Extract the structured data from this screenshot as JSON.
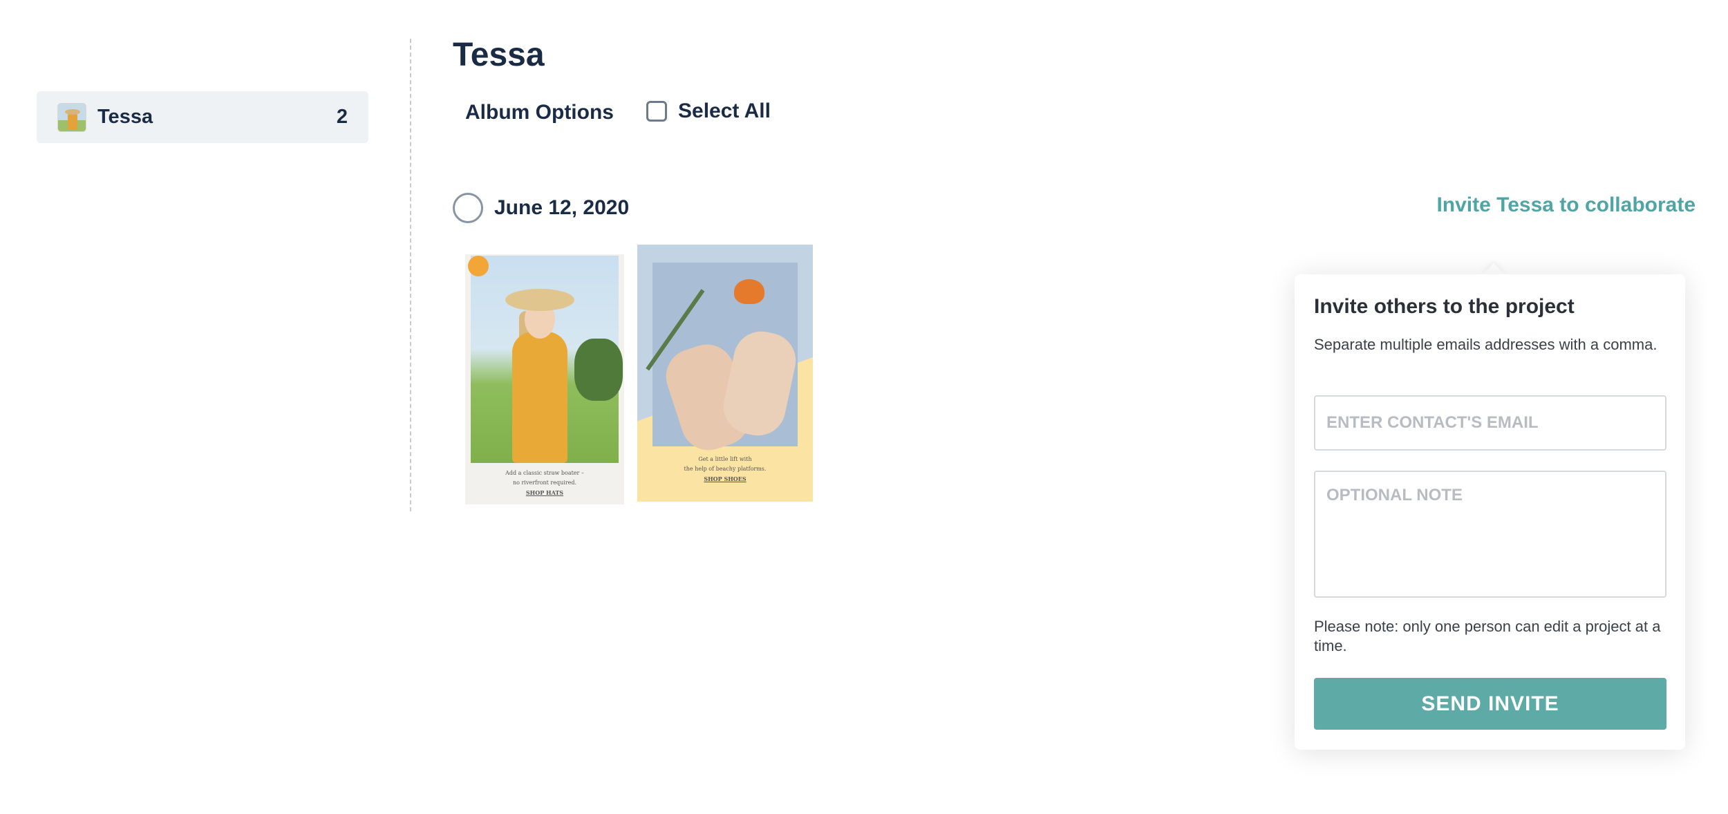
{
  "sidebar": {
    "album": {
      "name": "Tessa",
      "count": "2"
    }
  },
  "main": {
    "title": "Tessa",
    "album_options_label": "Album Options",
    "select_all_label": "Select All",
    "date_group": {
      "date": "June 12, 2020"
    },
    "invite_link": "Invite Tessa to collaborate",
    "photos": [
      {
        "caption_line1": "Add a classic straw boater –",
        "caption_line2": "no riverfront required.",
        "link": "SHOP HATS"
      },
      {
        "caption_line1": "Get a little lift with",
        "caption_line2": "the help of beachy platforms.",
        "link": "SHOP SHOES"
      }
    ]
  },
  "invite_popover": {
    "title": "Invite others to the project",
    "description": "Separate multiple emails addresses with a comma.",
    "email_placeholder": "ENTER CONTACT'S EMAIL",
    "note_placeholder": "OPTIONAL NOTE",
    "notice": "Please note: only one person can edit a project at a time.",
    "send_label": "SEND INVITE"
  },
  "colors": {
    "accent": "#5daaa7",
    "link": "#4ea5a4",
    "text": "#1a2b45",
    "sidebar_bg": "#eef2f4"
  }
}
